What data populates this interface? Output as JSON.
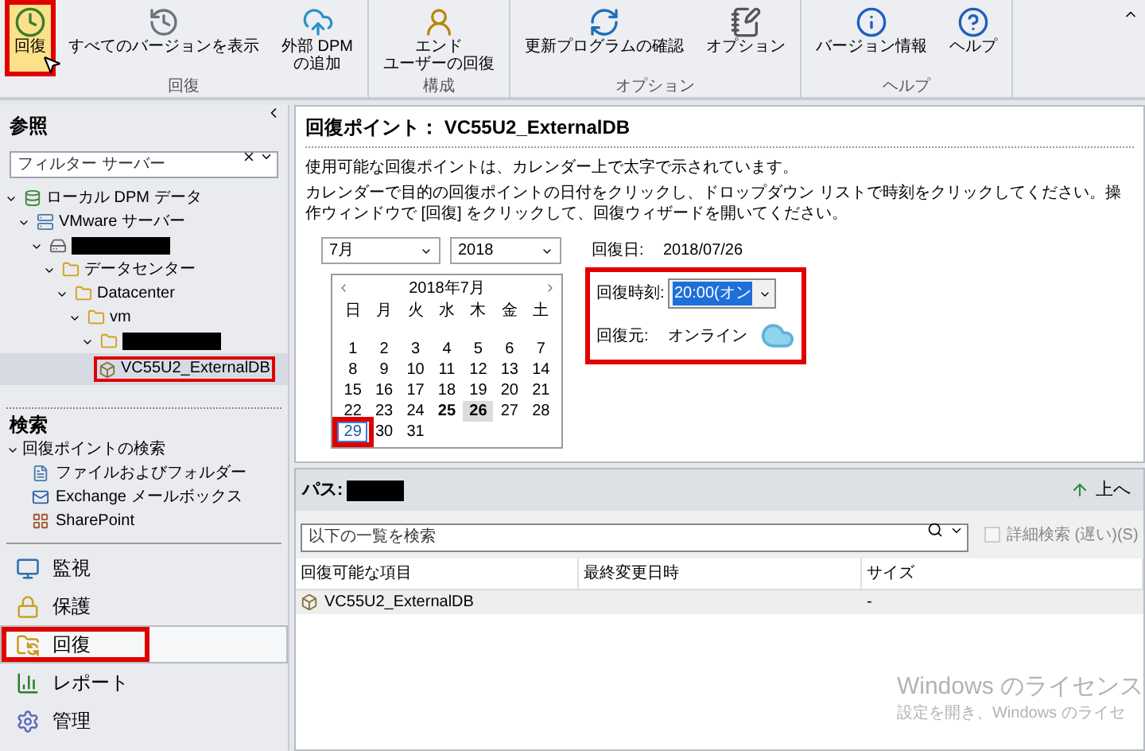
{
  "ribbon": {
    "groups": [
      {
        "label": "回復",
        "buttons": [
          {
            "lines": [
              "回復"
            ],
            "selected": true,
            "highlighted": true
          },
          {
            "lines": [
              "すべてのバージョンを表示"
            ],
            "selected": false,
            "highlighted": false
          },
          {
            "lines": [
              "外部 DPM",
              "の追加"
            ],
            "selected": false,
            "highlighted": false
          }
        ]
      },
      {
        "label": "構成",
        "buttons": [
          {
            "lines": [
              "エンド",
              "ユーザーの回復"
            ],
            "selected": false,
            "highlighted": false
          }
        ]
      },
      {
        "label": "オプション",
        "buttons": [
          {
            "lines": [
              "更新プログラムの確認"
            ],
            "selected": false,
            "highlighted": false
          },
          {
            "lines": [
              "オプション"
            ],
            "selected": false,
            "highlighted": false
          }
        ]
      },
      {
        "label": "ヘルプ",
        "buttons": [
          {
            "lines": [
              "バージョン情報"
            ],
            "selected": false,
            "highlighted": false
          },
          {
            "lines": [
              "ヘルプ"
            ],
            "selected": false,
            "highlighted": false
          }
        ]
      }
    ]
  },
  "browse": {
    "title": "参照",
    "filter": {
      "placeholder": "フィルター サーバー"
    },
    "tree": [
      {
        "label": "ローカル DPM データ",
        "expanded": true,
        "selected": false,
        "highlighted": false,
        "children": [
          {
            "label": "VMware サーバー",
            "expanded": true,
            "selected": false,
            "highlighted": false,
            "children": [
              {
                "redacted": true,
                "expanded": true,
                "selected": false,
                "highlighted": false,
                "children": [
                  {
                    "label": "データセンター",
                    "expanded": true,
                    "selected": false,
                    "highlighted": false,
                    "children": [
                      {
                        "label": "Datacenter",
                        "expanded": true,
                        "selected": false,
                        "highlighted": false,
                        "children": [
                          {
                            "label": "vm",
                            "expanded": true,
                            "selected": false,
                            "highlighted": false,
                            "children": [
                              {
                                "redacted": true,
                                "expanded": true,
                                "selected": false,
                                "highlighted": false,
                                "children": [
                                  {
                                    "label": "VC55U2_ExternalDB",
                                    "selected": true,
                                    "highlighted": true
                                  }
                                ]
                              }
                            ]
                          }
                        ]
                      }
                    ]
                  }
                ]
              }
            ]
          }
        ]
      }
    ]
  },
  "search_section": {
    "title": "検索",
    "items": [
      {
        "label": "回復ポイントの検索",
        "expanded": true,
        "children": [
          {
            "label": "ファイルおよびフォルダー"
          },
          {
            "label": "Exchange メールボックス"
          },
          {
            "label": "SharePoint"
          }
        ]
      }
    ]
  },
  "nav": [
    {
      "label": "監視",
      "selected": false,
      "highlighted": false
    },
    {
      "label": "保護",
      "selected": false,
      "highlighted": false
    },
    {
      "label": "回復",
      "selected": true,
      "highlighted": true
    },
    {
      "label": "レポート",
      "selected": false,
      "highlighted": false
    },
    {
      "label": "管理",
      "selected": false,
      "highlighted": false
    }
  ],
  "recovery": {
    "title": "回復ポイント： VC55U2_ExternalDB",
    "notes": [
      "使用可能な回復ポイントは、カレンダー上で太字で示されています。",
      "カレンダーで目的の回復ポイントの日付をクリックし、ドロップダウン リストで時刻をクリックしてください。操作ウィンドウで [回復] をクリックして、回復ウィザードを開いてください。"
    ],
    "month_select": "7月",
    "year_select": "2018",
    "calendar": {
      "title": "2018年7月",
      "weekdays": [
        "日",
        "月",
        "火",
        "水",
        "木",
        "金",
        "土"
      ],
      "days": [
        {
          "label": "1",
          "bold": false,
          "selected": false,
          "today": false,
          "highlighted": false
        },
        {
          "label": "2",
          "bold": false,
          "selected": false,
          "today": false,
          "highlighted": false
        },
        {
          "label": "3",
          "bold": false,
          "selected": false,
          "today": false,
          "highlighted": false
        },
        {
          "label": "4",
          "bold": false,
          "selected": false,
          "today": false,
          "highlighted": false
        },
        {
          "label": "5",
          "bold": false,
          "selected": false,
          "today": false,
          "highlighted": false
        },
        {
          "label": "6",
          "bold": false,
          "selected": false,
          "today": false,
          "highlighted": false
        },
        {
          "label": "7",
          "bold": false,
          "selected": false,
          "today": false,
          "highlighted": false
        },
        {
          "label": "8",
          "bold": false,
          "selected": false,
          "today": false,
          "highlighted": false
        },
        {
          "label": "9",
          "bold": false,
          "selected": false,
          "today": false,
          "highlighted": false
        },
        {
          "label": "10",
          "bold": false,
          "selected": false,
          "today": false,
          "highlighted": false
        },
        {
          "label": "11",
          "bold": false,
          "selected": false,
          "today": false,
          "highlighted": false
        },
        {
          "label": "12",
          "bold": false,
          "selected": false,
          "today": false,
          "highlighted": false
        },
        {
          "label": "13",
          "bold": false,
          "selected": false,
          "today": false,
          "highlighted": false
        },
        {
          "label": "14",
          "bold": false,
          "selected": false,
          "today": false,
          "highlighted": false
        },
        {
          "label": "15",
          "bold": false,
          "selected": false,
          "today": false,
          "highlighted": false
        },
        {
          "label": "16",
          "bold": false,
          "selected": false,
          "today": false,
          "highlighted": false
        },
        {
          "label": "17",
          "bold": false,
          "selected": false,
          "today": false,
          "highlighted": false
        },
        {
          "label": "18",
          "bold": false,
          "selected": false,
          "today": false,
          "highlighted": false
        },
        {
          "label": "19",
          "bold": false,
          "selected": false,
          "today": false,
          "highlighted": false
        },
        {
          "label": "20",
          "bold": false,
          "selected": false,
          "today": false,
          "highlighted": false
        },
        {
          "label": "21",
          "bold": false,
          "selected": false,
          "today": false,
          "highlighted": false
        },
        {
          "label": "22",
          "bold": false,
          "selected": false,
          "today": false,
          "highlighted": false
        },
        {
          "label": "23",
          "bold": false,
          "selected": false,
          "today": false,
          "highlighted": false
        },
        {
          "label": "24",
          "bold": false,
          "selected": false,
          "today": false,
          "highlighted": false
        },
        {
          "label": "25",
          "bold": true,
          "selected": false,
          "today": false,
          "highlighted": false
        },
        {
          "label": "26",
          "bold": true,
          "selected": true,
          "today": false,
          "highlighted": false
        },
        {
          "label": "27",
          "bold": false,
          "selected": false,
          "today": false,
          "highlighted": false
        },
        {
          "label": "28",
          "bold": false,
          "selected": false,
          "today": false,
          "highlighted": false
        },
        {
          "label": "29",
          "bold": false,
          "selected": false,
          "today": true,
          "highlighted": true
        },
        {
          "label": "30",
          "bold": false,
          "selected": false,
          "today": false,
          "highlighted": false
        },
        {
          "label": "31",
          "bold": false,
          "selected": false,
          "today": false,
          "highlighted": false
        }
      ]
    },
    "details": {
      "date_label": "回復日:",
      "date": "2018/07/26",
      "time_label": "回復時刻:",
      "time": "20:00(オン",
      "time_selected": true,
      "source_label": "回復元:",
      "source": "オンライン",
      "highlighted": true
    }
  },
  "browser": {
    "path_label": "パス:",
    "path_redacted": true,
    "up_button": "上へ",
    "search": {
      "placeholder": "以下の一覧を検索"
    },
    "detailed_search": {
      "label": "詳細検索 (遅い)(S)",
      "checked": false,
      "disabled": true
    },
    "table": {
      "columns": [
        "回復可能な項目",
        "最終変更日時",
        "サイズ"
      ],
      "rows": [
        {
          "item": "VC55U2_ExternalDB",
          "size": "-",
          "selected": true
        }
      ]
    }
  },
  "activation_notice": [
    "Windows のライセンス",
    "設定を開き、Windows のライセ"
  ]
}
